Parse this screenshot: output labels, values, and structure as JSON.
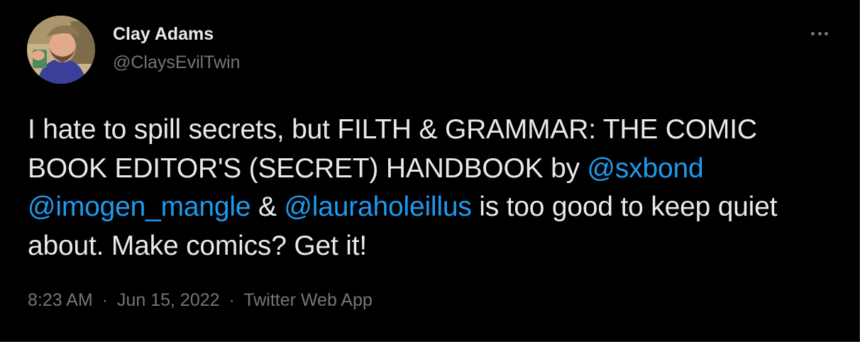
{
  "author": {
    "display_name": "Clay Adams",
    "handle": "@ClaysEvilTwin",
    "avatar_icon": "user-avatar"
  },
  "more_icon": "more-horizontal-icon",
  "tweet": {
    "text_part1": "I hate to spill secrets, but FILTH & GRAMMAR: THE COMIC BOOK EDITOR'S (SECRET) HANDBOOK by ",
    "mention1": "@sxbond",
    "text_part2": " ",
    "mention2": "@imogen_mangle",
    "text_part3": " & ",
    "mention3": "@lauraholeillus",
    "text_part4": " is too good to keep quiet about. Make comics? Get it!"
  },
  "meta": {
    "time": "8:23 AM",
    "separator": "·",
    "date": "Jun 15, 2022",
    "source": "Twitter Web App"
  },
  "colors": {
    "background": "#000000",
    "text": "#e7e9ea",
    "secondary": "#71767b",
    "link": "#1d9bf0",
    "border": "#2f3336"
  }
}
